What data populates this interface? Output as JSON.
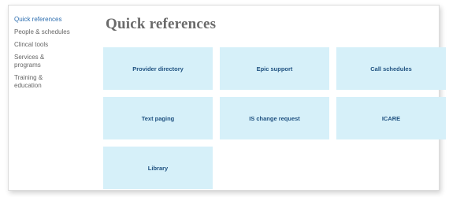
{
  "sidebar": {
    "items": [
      {
        "label": "Quick references",
        "active": true
      },
      {
        "label": "People & schedules",
        "active": false
      },
      {
        "label": "Clincal tools",
        "active": false
      },
      {
        "label": "Services &\nprograms",
        "active": false
      },
      {
        "label": "Training &\neducation",
        "active": false
      }
    ]
  },
  "main": {
    "title": "Quick references",
    "tiles": [
      {
        "label": "Provider directory"
      },
      {
        "label": "Epic support"
      },
      {
        "label": "Call schedules"
      },
      {
        "label": "Text paging"
      },
      {
        "label": "IS change request"
      },
      {
        "label": "ICARE"
      },
      {
        "label": "Library"
      }
    ]
  },
  "colors": {
    "accent": "#2f6fb0",
    "tile_background": "#d6f0f9",
    "tile_text": "#1f5180",
    "muted_text": "#666666"
  }
}
